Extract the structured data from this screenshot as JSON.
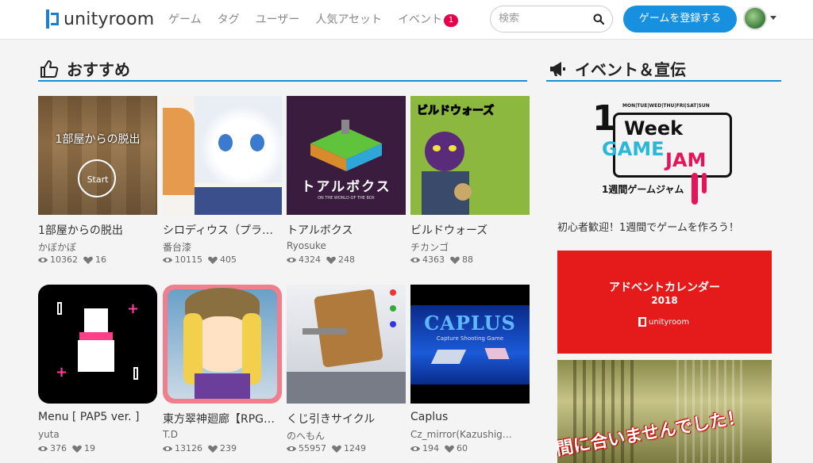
{
  "header": {
    "logo_text": "unityroom",
    "nav": [
      "ゲーム",
      "タグ",
      "ユーザー",
      "人気アセット",
      "イベント"
    ],
    "event_badge": "1",
    "search_placeholder": "検索",
    "register_label": "ゲームを登録する"
  },
  "colors": {
    "accent": "#1890e0",
    "badge": "#e6004c",
    "title_line": "#1b8fd6"
  },
  "recommended": {
    "title": "おすすめ",
    "games": [
      {
        "title": "1部屋からの脱出",
        "author": "かぼかぼ",
        "views": "10362",
        "likes": "16",
        "thumb_text": "1部屋からの脱出",
        "thumb_sub": "Start"
      },
      {
        "title": "シロディウス（プラ…",
        "author": "番台漆",
        "views": "10115",
        "likes": "405"
      },
      {
        "title": "トアルボクス",
        "author": "Ryosuke",
        "views": "4324",
        "likes": "248",
        "thumb_text": "トアルボクス",
        "thumb_sub": "ON THE WORLD OF THE BOX"
      },
      {
        "title": "ビルドウォーズ",
        "author": "チカンゴ",
        "views": "4363",
        "likes": "88",
        "thumb_text": "ビルドウォーズ"
      },
      {
        "title": "Menu [ PAP5 ver. ]",
        "author": "yuta",
        "views": "376",
        "likes": "19"
      },
      {
        "title": "東方翠神廻廊【RPG…",
        "author": "T.D",
        "views": "13126",
        "likes": "239"
      },
      {
        "title": "くじ引きサイクル",
        "author": "のへもん",
        "views": "55957",
        "likes": "1249"
      },
      {
        "title": "Caplus",
        "author": "Cz_mirror(Kazushig…",
        "views": "194",
        "likes": "60",
        "thumb_text": "CAPLUS",
        "thumb_sub": "Capture Shooting Game"
      }
    ]
  },
  "events": {
    "title": "イベント＆宣伝",
    "jam": {
      "days": "MON|TUE|WED|THU|FRI|SAT|SUN",
      "line1": "1",
      "week": "Week",
      "game": "GAME",
      "jam": "JAM",
      "sub": "1週間ゲームジャム",
      "caption": "初心者歓迎！1週間でゲームを作ろう！"
    },
    "advent": {
      "line1": "アドベントカレンダー",
      "line2": "2018",
      "logo": "unityroom"
    },
    "third": {
      "text": "間に合いませんでした！"
    }
  }
}
